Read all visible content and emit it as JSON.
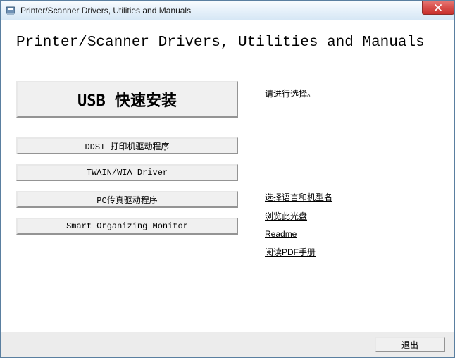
{
  "window": {
    "title": "Printer/Scanner Drivers, Utilities and Manuals"
  },
  "page": {
    "heading": "Printer/Scanner Drivers, Utilities and Manuals"
  },
  "buttons": {
    "usb_quick_install": "USB 快速安装",
    "ddst_driver": "DDST 打印机驱动程序",
    "twain_wia_driver": "TWAIN/WIA Driver",
    "pc_fax_driver": "PC传真驱动程序",
    "smart_organizing_monitor": "Smart Organizing Monitor"
  },
  "right": {
    "instruction": "请进行选择。",
    "links": {
      "select_language_model": "选择语言和机型名",
      "browse_disc": "浏览此光盘",
      "readme": "Readme",
      "read_pdf_manual": "阅读PDF手册"
    }
  },
  "footer": {
    "exit": "退出"
  }
}
